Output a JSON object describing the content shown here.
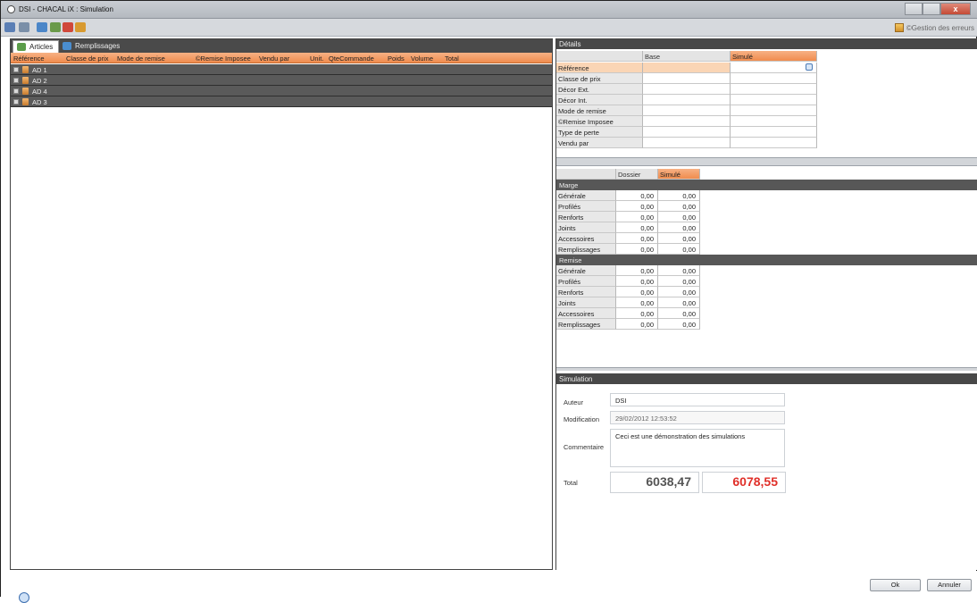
{
  "window": {
    "title": "DSI - CHACAL iX : Simulation",
    "close_label": "x"
  },
  "toolbar": {
    "error_link": "©Gestion des erreurs"
  },
  "tabs": [
    {
      "label": "Articles"
    },
    {
      "label": "Remplissages"
    }
  ],
  "grid": {
    "columns": [
      "Référence",
      "Classe de prix",
      "Mode de remise",
      "©Remise Imposee",
      "Vendu par",
      "Unit.",
      "QteCommande",
      "Poids",
      "Volume",
      "Total"
    ],
    "rows": [
      "AD 1",
      "AD 2",
      "AD 4",
      "AD 3"
    ]
  },
  "details": {
    "title": "Détails",
    "col_base": "Base",
    "col_simule": "Simulé",
    "rows": [
      "Référence",
      "Classe de prix",
      "Décor Ext.",
      "Décor Int.",
      "Mode de remise",
      "©Remise Imposee",
      "Type de perte",
      "Vendu par"
    ]
  },
  "margins": {
    "col_dossier": "Dossier",
    "col_simule": "Simulé",
    "sections": [
      {
        "title": "Marge",
        "rows": [
          {
            "label": "Générale",
            "dossier": "0,00",
            "simule": "0,00"
          },
          {
            "label": "Profilés",
            "dossier": "0,00",
            "simule": "0,00"
          },
          {
            "label": "Renforts",
            "dossier": "0,00",
            "simule": "0,00"
          },
          {
            "label": "Joints",
            "dossier": "0,00",
            "simule": "0,00"
          },
          {
            "label": "Accessoires",
            "dossier": "0,00",
            "simule": "0,00"
          },
          {
            "label": "Remplissages",
            "dossier": "0,00",
            "simule": "0,00"
          }
        ]
      },
      {
        "title": "Remise",
        "rows": [
          {
            "label": "Générale",
            "dossier": "0,00",
            "simule": "0,00"
          },
          {
            "label": "Profilés",
            "dossier": "0,00",
            "simule": "0,00"
          },
          {
            "label": "Renforts",
            "dossier": "0,00",
            "simule": "0,00"
          },
          {
            "label": "Joints",
            "dossier": "0,00",
            "simule": "0,00"
          },
          {
            "label": "Accessoires",
            "dossier": "0,00",
            "simule": "0,00"
          },
          {
            "label": "Remplissages",
            "dossier": "0,00",
            "simule": "0,00"
          }
        ]
      }
    ]
  },
  "simulation": {
    "title": "Simulation",
    "auteur_label": "Auteur",
    "auteur": "DSI",
    "modification_label": "Modification",
    "modification": "29/02/2012 12:53:52",
    "commentaire_label": "Commentaire",
    "commentaire": "Ceci est une démonstration des simulations",
    "total_label": "Total",
    "total_base": "6038,47",
    "total_simule": "6078,55",
    "total_simule_color": "#e0302a"
  },
  "buttons": {
    "ok": "Ok",
    "annuler": "Annuler"
  },
  "colors": {
    "accent": "#f08c4e",
    "dark_header": "#484848"
  }
}
